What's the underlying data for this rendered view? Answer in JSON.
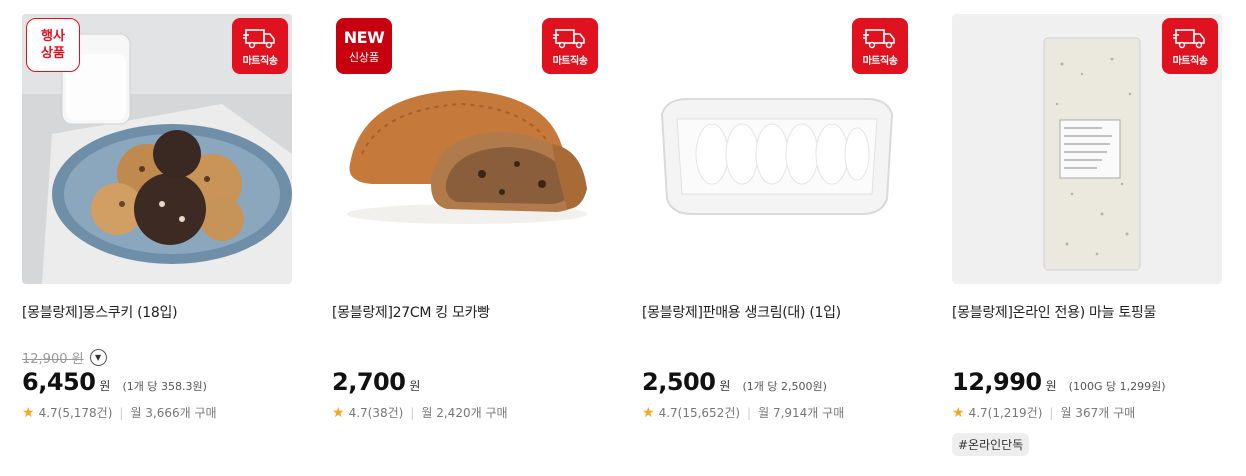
{
  "products": [
    {
      "badge_left_type": "event",
      "badge_left_lines": [
        "행사",
        "상품"
      ],
      "badge_right": "마트직송",
      "image": "cookies-on-plate",
      "title": "[몽블랑제]몽스쿠키 (18입)",
      "original_price": "12,900",
      "original_won": "원",
      "price": "6,450",
      "won": "원",
      "unit_price": "(1개 당 358.3원)",
      "rating": "4.7(5,178건)",
      "monthly": "월 3,666개 구매",
      "tag": ""
    },
    {
      "badge_left_type": "new",
      "badge_left_lines": [
        "NEW",
        "신상품"
      ],
      "badge_right": "마트직송",
      "image": "mocha-bread",
      "title": "[몽블랑제]27CM 킹 모카빵",
      "price": "2,700",
      "won": "원",
      "unit_price": "",
      "rating": "4.7(38건)",
      "monthly": "월 2,420개 구매",
      "tag": ""
    },
    {
      "badge_left_type": "",
      "badge_right": "마트직송",
      "image": "cream-container",
      "title": "[몽블랑제]판매용 생크림(대) (1입)",
      "price": "2,500",
      "won": "원",
      "unit_price": "(1개 당 2,500원)",
      "rating": "4.7(15,652건)",
      "monthly": "월 7,914개 구매",
      "tag": ""
    },
    {
      "badge_left_type": "",
      "badge_right": "마트직송",
      "image": "garlic-topping-pack",
      "title": "[몽블랑제]온라인 전용) 마늘 토핑물",
      "price": "12,990",
      "won": "원",
      "unit_price": "(100G 당 1,299원)",
      "rating": "4.7(1,219건)",
      "monthly": "월 367개 구매",
      "tag": "#온라인단독"
    }
  ],
  "icons": {
    "truck": "delivery-truck-icon",
    "star": "star-icon",
    "dropdown": "chevron-down-circle-icon"
  },
  "colors": {
    "accent": "#e1121f",
    "new_badge": "#c7000f",
    "star": "#f5a623"
  }
}
